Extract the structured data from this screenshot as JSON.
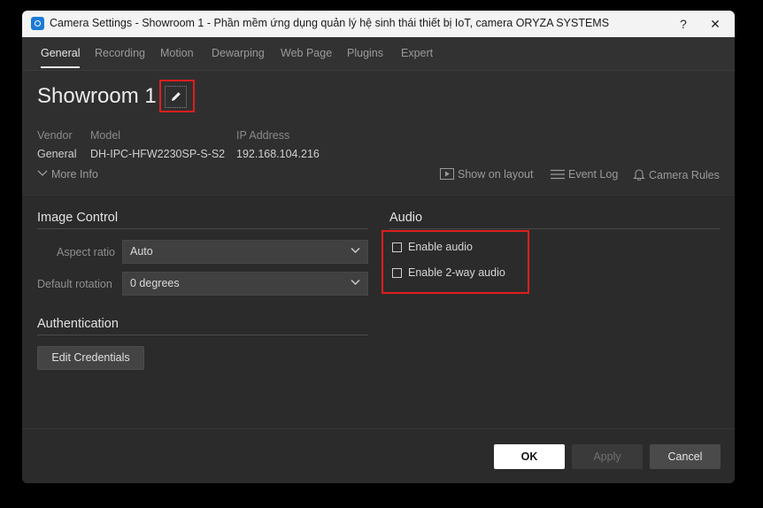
{
  "window": {
    "title": "Camera Settings - Showroom 1 - Phần mềm ứng dụng quản lý hệ sinh thái thiết bị IoT, camera ORYZA SYSTEMS",
    "help_label": "?",
    "close_label": "✕"
  },
  "tabs": [
    {
      "label": "General",
      "active": true
    },
    {
      "label": "Recording"
    },
    {
      "label": "Motion"
    },
    {
      "label": "Dewarping"
    },
    {
      "label": "Web Page"
    },
    {
      "label": "Plugins"
    },
    {
      "label": "Expert"
    }
  ],
  "camera": {
    "name": "Showroom 1",
    "vendor_label": "Vendor",
    "vendor_value": "General",
    "model_label": "Model",
    "model_value": "DH-IPC-HFW2230SP-S-S2",
    "ip_label": "IP Address",
    "ip_value": "192.168.104.216"
  },
  "actions": {
    "more_info": "More Info",
    "show_on_layout": "Show on layout",
    "event_log": "Event Log",
    "camera_rules": "Camera Rules"
  },
  "image_control": {
    "title": "Image Control",
    "aspect_ratio_label": "Aspect ratio",
    "aspect_ratio_value": "Auto",
    "default_rotation_label": "Default rotation",
    "default_rotation_value": "0 degrees"
  },
  "authentication": {
    "title": "Authentication",
    "edit_credentials": "Edit Credentials"
  },
  "audio": {
    "title": "Audio",
    "enable_audio": "Enable audio",
    "enable_audio_checked": false,
    "enable_2way": "Enable 2-way audio",
    "enable_2way_checked": false
  },
  "footer": {
    "ok": "OK",
    "apply": "Apply",
    "cancel": "Cancel"
  },
  "colors": {
    "highlight": "#e01e1e",
    "app_icon": "#1c7bd8"
  }
}
